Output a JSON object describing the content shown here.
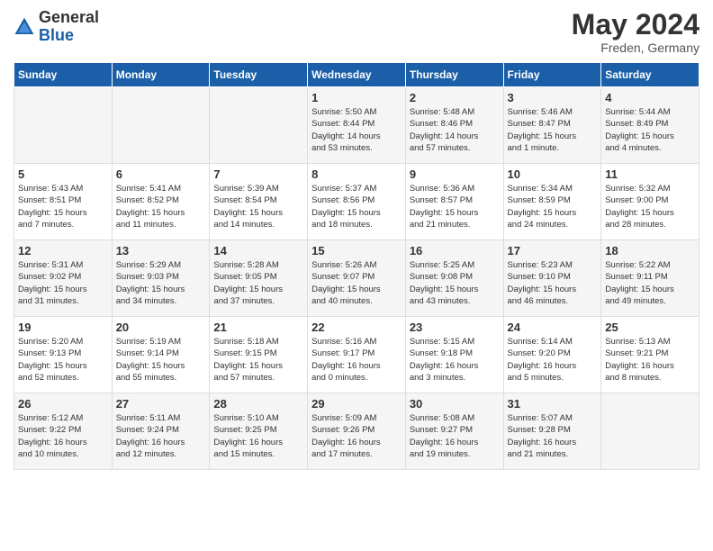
{
  "header": {
    "logo_general": "General",
    "logo_blue": "Blue",
    "month_year": "May 2024",
    "location": "Freden, Germany"
  },
  "days_of_week": [
    "Sunday",
    "Monday",
    "Tuesday",
    "Wednesday",
    "Thursday",
    "Friday",
    "Saturday"
  ],
  "weeks": [
    [
      {
        "num": "",
        "info": ""
      },
      {
        "num": "",
        "info": ""
      },
      {
        "num": "",
        "info": ""
      },
      {
        "num": "1",
        "info": "Sunrise: 5:50 AM\nSunset: 8:44 PM\nDaylight: 14 hours\nand 53 minutes."
      },
      {
        "num": "2",
        "info": "Sunrise: 5:48 AM\nSunset: 8:46 PM\nDaylight: 14 hours\nand 57 minutes."
      },
      {
        "num": "3",
        "info": "Sunrise: 5:46 AM\nSunset: 8:47 PM\nDaylight: 15 hours\nand 1 minute."
      },
      {
        "num": "4",
        "info": "Sunrise: 5:44 AM\nSunset: 8:49 PM\nDaylight: 15 hours\nand 4 minutes."
      }
    ],
    [
      {
        "num": "5",
        "info": "Sunrise: 5:43 AM\nSunset: 8:51 PM\nDaylight: 15 hours\nand 7 minutes."
      },
      {
        "num": "6",
        "info": "Sunrise: 5:41 AM\nSunset: 8:52 PM\nDaylight: 15 hours\nand 11 minutes."
      },
      {
        "num": "7",
        "info": "Sunrise: 5:39 AM\nSunset: 8:54 PM\nDaylight: 15 hours\nand 14 minutes."
      },
      {
        "num": "8",
        "info": "Sunrise: 5:37 AM\nSunset: 8:56 PM\nDaylight: 15 hours\nand 18 minutes."
      },
      {
        "num": "9",
        "info": "Sunrise: 5:36 AM\nSunset: 8:57 PM\nDaylight: 15 hours\nand 21 minutes."
      },
      {
        "num": "10",
        "info": "Sunrise: 5:34 AM\nSunset: 8:59 PM\nDaylight: 15 hours\nand 24 minutes."
      },
      {
        "num": "11",
        "info": "Sunrise: 5:32 AM\nSunset: 9:00 PM\nDaylight: 15 hours\nand 28 minutes."
      }
    ],
    [
      {
        "num": "12",
        "info": "Sunrise: 5:31 AM\nSunset: 9:02 PM\nDaylight: 15 hours\nand 31 minutes."
      },
      {
        "num": "13",
        "info": "Sunrise: 5:29 AM\nSunset: 9:03 PM\nDaylight: 15 hours\nand 34 minutes."
      },
      {
        "num": "14",
        "info": "Sunrise: 5:28 AM\nSunset: 9:05 PM\nDaylight: 15 hours\nand 37 minutes."
      },
      {
        "num": "15",
        "info": "Sunrise: 5:26 AM\nSunset: 9:07 PM\nDaylight: 15 hours\nand 40 minutes."
      },
      {
        "num": "16",
        "info": "Sunrise: 5:25 AM\nSunset: 9:08 PM\nDaylight: 15 hours\nand 43 minutes."
      },
      {
        "num": "17",
        "info": "Sunrise: 5:23 AM\nSunset: 9:10 PM\nDaylight: 15 hours\nand 46 minutes."
      },
      {
        "num": "18",
        "info": "Sunrise: 5:22 AM\nSunset: 9:11 PM\nDaylight: 15 hours\nand 49 minutes."
      }
    ],
    [
      {
        "num": "19",
        "info": "Sunrise: 5:20 AM\nSunset: 9:13 PM\nDaylight: 15 hours\nand 52 minutes."
      },
      {
        "num": "20",
        "info": "Sunrise: 5:19 AM\nSunset: 9:14 PM\nDaylight: 15 hours\nand 55 minutes."
      },
      {
        "num": "21",
        "info": "Sunrise: 5:18 AM\nSunset: 9:15 PM\nDaylight: 15 hours\nand 57 minutes."
      },
      {
        "num": "22",
        "info": "Sunrise: 5:16 AM\nSunset: 9:17 PM\nDaylight: 16 hours\nand 0 minutes."
      },
      {
        "num": "23",
        "info": "Sunrise: 5:15 AM\nSunset: 9:18 PM\nDaylight: 16 hours\nand 3 minutes."
      },
      {
        "num": "24",
        "info": "Sunrise: 5:14 AM\nSunset: 9:20 PM\nDaylight: 16 hours\nand 5 minutes."
      },
      {
        "num": "25",
        "info": "Sunrise: 5:13 AM\nSunset: 9:21 PM\nDaylight: 16 hours\nand 8 minutes."
      }
    ],
    [
      {
        "num": "26",
        "info": "Sunrise: 5:12 AM\nSunset: 9:22 PM\nDaylight: 16 hours\nand 10 minutes."
      },
      {
        "num": "27",
        "info": "Sunrise: 5:11 AM\nSunset: 9:24 PM\nDaylight: 16 hours\nand 12 minutes."
      },
      {
        "num": "28",
        "info": "Sunrise: 5:10 AM\nSunset: 9:25 PM\nDaylight: 16 hours\nand 15 minutes."
      },
      {
        "num": "29",
        "info": "Sunrise: 5:09 AM\nSunset: 9:26 PM\nDaylight: 16 hours\nand 17 minutes."
      },
      {
        "num": "30",
        "info": "Sunrise: 5:08 AM\nSunset: 9:27 PM\nDaylight: 16 hours\nand 19 minutes."
      },
      {
        "num": "31",
        "info": "Sunrise: 5:07 AM\nSunset: 9:28 PM\nDaylight: 16 hours\nand 21 minutes."
      },
      {
        "num": "",
        "info": ""
      }
    ]
  ]
}
